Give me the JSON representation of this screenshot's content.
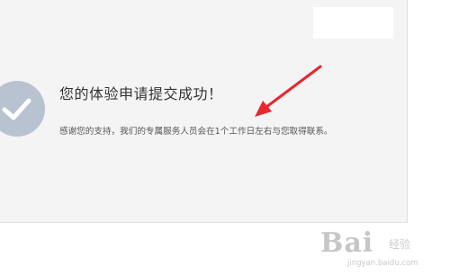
{
  "success": {
    "title": "您的体验申请提交成功！",
    "description": "感谢您的支持，我们的专属服务人员会在1个工作日左右与您取得联系。"
  },
  "colors": {
    "panel_bg": "#f4f4f5",
    "check_circle": "#b8c2d1",
    "arrow": "#e8262e"
  },
  "icons": {
    "status": "check-circle-icon",
    "annotation": "red-arrow-icon"
  },
  "watermark": {
    "logo": "Bai",
    "text": "经验",
    "url": "jingyan.baidu.com"
  }
}
